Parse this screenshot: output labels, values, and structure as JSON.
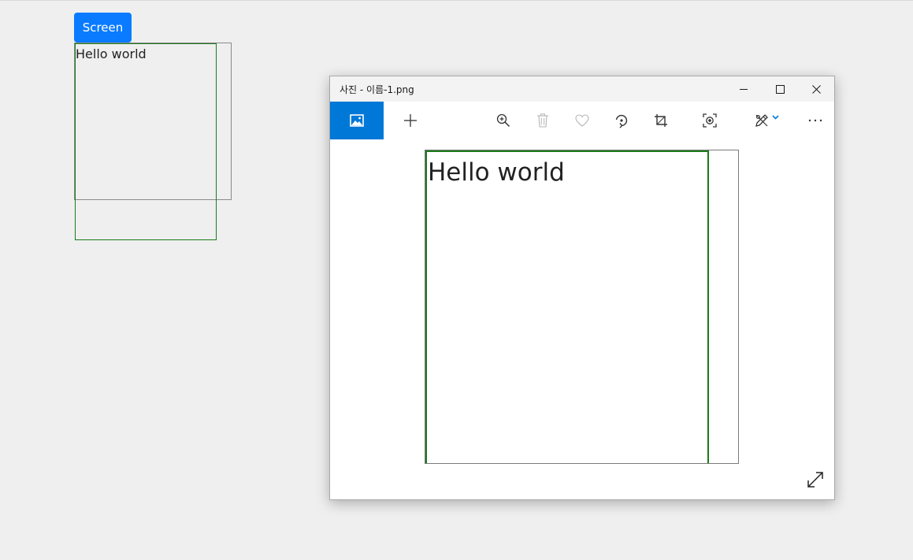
{
  "page": {
    "screen_button_label": "Screen",
    "hello_text": "Hello world"
  },
  "photos_window": {
    "title": "사진 - 이름-1.png",
    "caption_buttons": [
      "minimize-icon",
      "maximize-icon",
      "close-icon"
    ],
    "toolbar_icons": [
      "view-image-icon",
      "add-icon",
      "zoom-in-icon",
      "delete-icon",
      "favorite-icon",
      "rotate-icon",
      "crop-icon",
      "enhance-icon",
      "edit-draw-icon",
      "chevron-down-icon",
      "more-options-icon"
    ],
    "image_text": "Hello world",
    "fullscreen_icon": "fullscreen-icon",
    "colors": {
      "accent": "#0078d7",
      "screen_button": "#0a7bff",
      "green_frame": "#1a7a1a"
    }
  }
}
